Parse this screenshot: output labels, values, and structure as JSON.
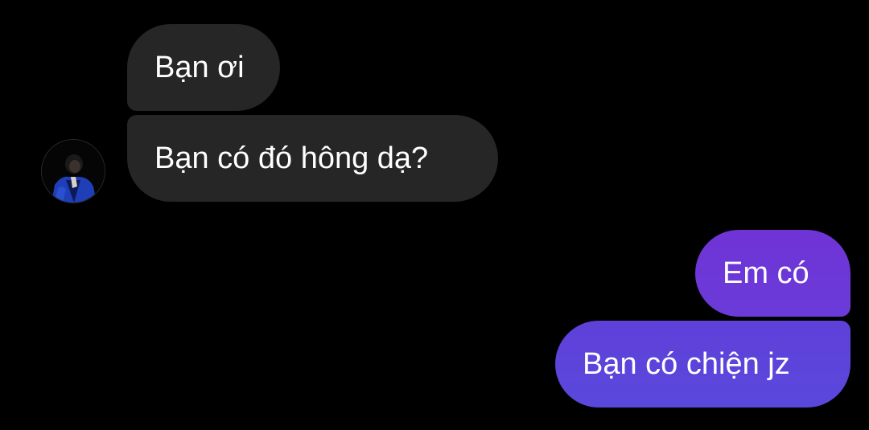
{
  "conversation": {
    "incoming": [
      {
        "text": "Bạn ơi"
      },
      {
        "text": "Bạn có đó hông dạ?"
      }
    ],
    "outgoing": [
      {
        "text": "Em có"
      },
      {
        "text": "Bạn có chiện jz"
      }
    ],
    "contact": {
      "avatar_icon": "profile-photo"
    }
  },
  "colors": {
    "background": "#000000",
    "incoming_bubble": "#262626",
    "outgoing_bubble_top": "#6f33d6",
    "outgoing_bubble_bottom": "#5a48dc",
    "text": "#ffffff"
  }
}
